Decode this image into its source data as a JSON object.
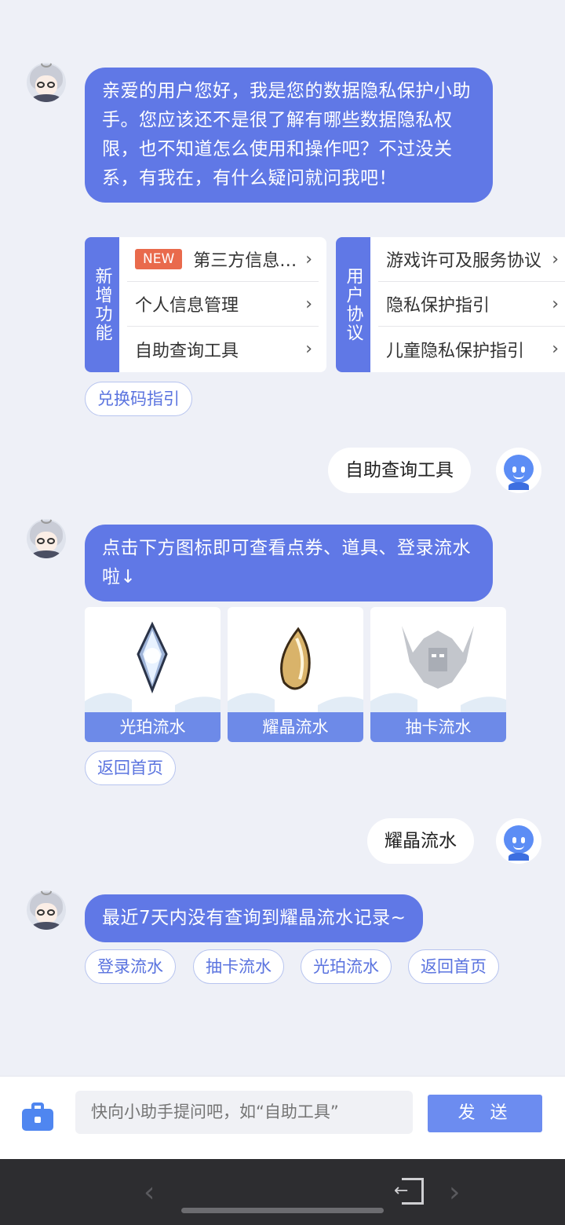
{
  "messages": {
    "greeting": "亲爱的用户您好，我是您的数据隐私保护小助手。您应该还不是很了解有哪些数据隐私权限，也不知道怎么使用和操作吧？不过没关系，有我在，有什么疑问就问我吧！",
    "user_query_1": "自助查询工具",
    "tool_hint": "点击下方图标即可查看点券、道具、登录流水啦↓",
    "user_query_2": "耀晶流水",
    "no_record": "最近7天内没有查询到耀晶流水记录~"
  },
  "card_new_features": {
    "side_label": "新增功能",
    "new_badge": "NEW",
    "items": [
      "第三方信息…",
      "个人信息管理",
      "自助查询工具"
    ]
  },
  "card_user_agreement": {
    "side_label": "用户协议",
    "items": [
      "游戏许可及服务协议",
      "隐私保护指引",
      "儿童隐私保护指引"
    ]
  },
  "chips": {
    "redeem_guide": "兑换码指引",
    "back_home_1": "返回首页",
    "login_flow": "登录流水",
    "gacha_flow": "抽卡流水",
    "amber_flow": "光珀流水",
    "back_home_2": "返回首页"
  },
  "tiles": [
    "光珀流水",
    "耀晶流水",
    "抽卡流水"
  ],
  "input": {
    "placeholder": "快向小助手提问吧，如“自助工具”",
    "send_label": "发 送"
  },
  "colors": {
    "bot_bubble": "#6078e6",
    "chip_text": "#5a73df",
    "new_badge": "#e96a4c",
    "send_button": "#6c8cf0"
  }
}
